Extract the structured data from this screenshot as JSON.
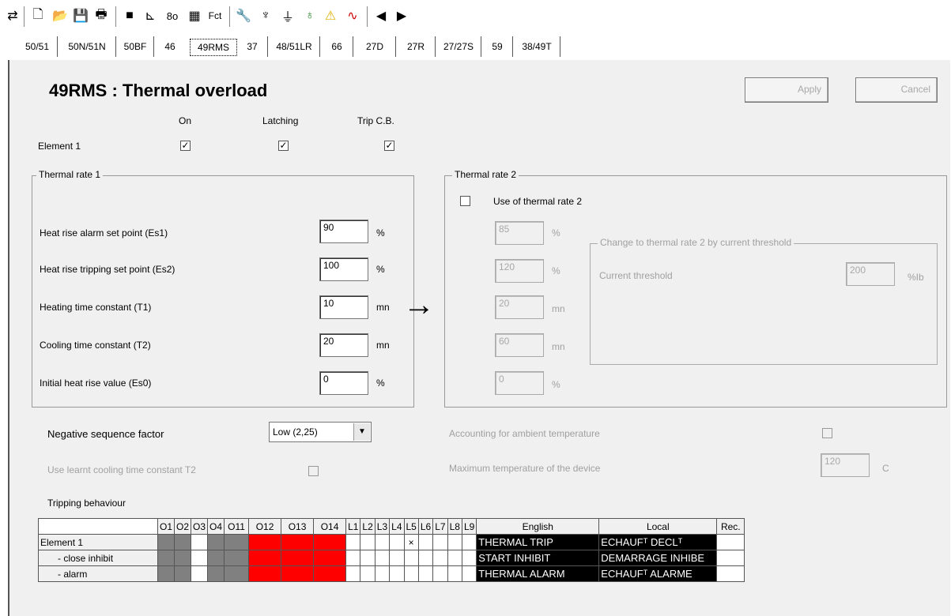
{
  "tabs": [
    "50/51",
    "50N/51N",
    "50BF",
    "46",
    "49RMS",
    "37",
    "48/51LR",
    "66",
    "27D",
    "27R",
    "27/27S",
    "59",
    "38/49T"
  ],
  "active_tab": "49RMS",
  "title": "49RMS : Thermal overload",
  "buttons": {
    "apply": "Apply",
    "cancel": "Cancel"
  },
  "headers": {
    "on": "On",
    "latching": "Latching",
    "trip": "Trip C.B."
  },
  "element_label": "Element 1",
  "rate1": {
    "label": "Thermal rate 1",
    "rows": [
      {
        "label": "Heat rise alarm set point (Es1)",
        "value": "90",
        "unit": "%"
      },
      {
        "label": "Heat rise tripping set point (Es2)",
        "value": "100",
        "unit": "%"
      },
      {
        "label": "Heating time constant (T1)",
        "value": "10",
        "unit": "mn"
      },
      {
        "label": "Cooling time constant (T2)",
        "value": "20",
        "unit": "mn"
      },
      {
        "label": "Initial heat rise value (Es0)",
        "value": "0",
        "unit": "%"
      }
    ]
  },
  "rate2": {
    "label": "Thermal rate 2",
    "use_label": "Use of thermal rate 2",
    "values": [
      {
        "value": "85",
        "unit": "%"
      },
      {
        "value": "120",
        "unit": "%"
      },
      {
        "value": "20",
        "unit": "mn"
      },
      {
        "value": "60",
        "unit": "mn"
      },
      {
        "value": "0",
        "unit": "%"
      }
    ],
    "threshold_group": "Change to thermal rate 2 by current threshold",
    "threshold_label": "Current threshold",
    "threshold_value": "200",
    "threshold_unit": "%Ib"
  },
  "neg_seq": {
    "label": "Negative sequence factor",
    "value": "Low (2,25)"
  },
  "learnt": "Use learnt cooling time constant T2",
  "ambient": "Accounting for ambient temperature",
  "max_temp": {
    "label": "Maximum temperature of the device",
    "value": "120",
    "unit": "C"
  },
  "tripping": {
    "label": "Tripping behaviour",
    "columns": [
      "O1",
      "O2",
      "O3",
      "O4",
      "O11",
      "O12",
      "O13",
      "O14",
      "L1",
      "L2",
      "L3",
      "L4",
      "L5",
      "L6",
      "L7",
      "L8",
      "L9",
      "English",
      "Local",
      "Rec."
    ],
    "rows": [
      {
        "name": "Element 1",
        "english": "THERMAL TRIP",
        "local": "ECHAUFᵀ DECLᵀ",
        "mark": "×"
      },
      {
        "name": "- close inhibit",
        "english": "START INHIBIT",
        "local": "DEMARRAGE INHIBE",
        "mark": ""
      },
      {
        "name": "- alarm",
        "english": "THERMAL ALARM",
        "local": "ECHAUFᵀ ALARME",
        "mark": ""
      }
    ]
  },
  "arrow": "→",
  "toolbar_icons": [
    "connect-icon",
    "new-file-icon",
    "open-folder-icon",
    "save-icon",
    "print-icon",
    "disk-icon",
    "curve-icon",
    "logic-icon",
    "matrix-icon",
    "fct-icon",
    "wrench-icon",
    "tower-icon",
    "network-icon",
    "stethoscope-icon",
    "warning-icon",
    "waveform-icon",
    "prev-icon",
    "next-icon"
  ],
  "fct_label": "Fct"
}
